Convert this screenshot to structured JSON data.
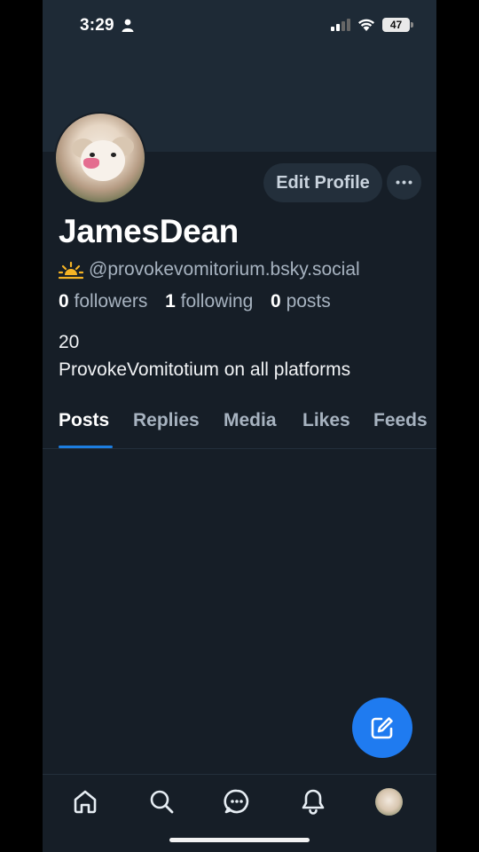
{
  "status_bar": {
    "time": "3:29",
    "battery": "47"
  },
  "profile": {
    "edit_button": "Edit Profile",
    "display_name": "JamesDean",
    "handle": "@provokevomitorium.bsky.social",
    "followers_count": "0",
    "followers_label": "followers",
    "following_count": "1",
    "following_label": "following",
    "posts_count": "0",
    "posts_label": "posts",
    "bio_line1": "20",
    "bio_line2": "ProvokeVomitotium on all platforms"
  },
  "tabs": [
    {
      "label": "Posts",
      "active": true
    },
    {
      "label": "Replies"
    },
    {
      "label": "Media"
    },
    {
      "label": "Likes"
    },
    {
      "label": "Feeds"
    }
  ],
  "colors": {
    "background": "#161e27",
    "accent": "#1f7bf0",
    "muted": "#a7b3c0"
  },
  "icons": [
    "person-icon",
    "signal-icon",
    "wifi-icon",
    "battery-icon",
    "more-icon",
    "sun-icon",
    "compose-icon",
    "home-icon",
    "search-icon",
    "chat-icon",
    "bell-icon"
  ]
}
